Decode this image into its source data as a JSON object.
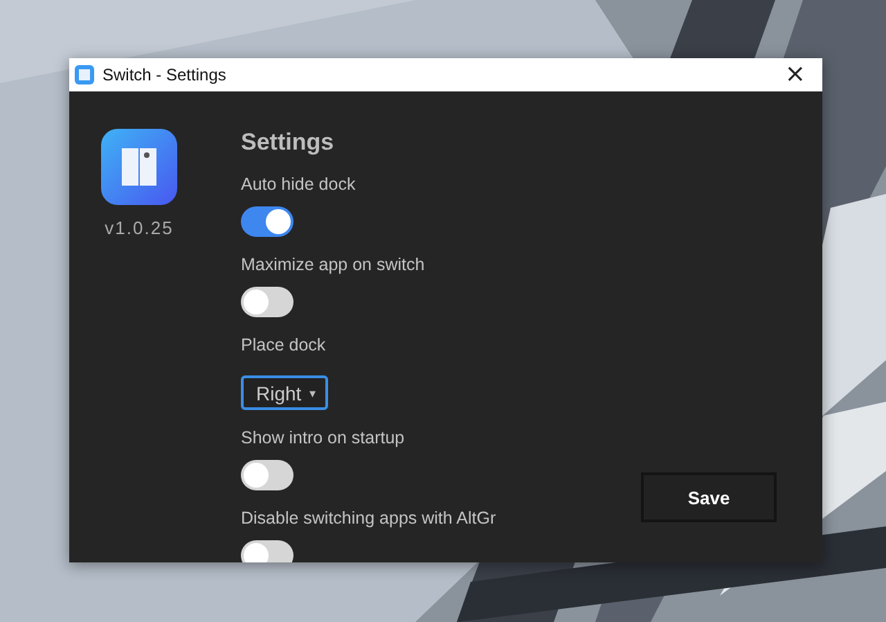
{
  "window": {
    "title": "Switch - Settings",
    "close": "×"
  },
  "app": {
    "version": "v1.0.25"
  },
  "heading": "Settings",
  "settings": [
    {
      "kind": "toggle",
      "label": "Auto hide dock",
      "on": true
    },
    {
      "kind": "toggle",
      "label": "Maximize app on switch",
      "on": false
    },
    {
      "kind": "select",
      "label": "Place dock",
      "value": "Right",
      "caret": "▾"
    },
    {
      "kind": "toggle",
      "label": "Show intro on startup",
      "on": false
    },
    {
      "kind": "toggle",
      "label": "Disable switching apps with AltGr",
      "on": false
    }
  ],
  "save_button": "Save"
}
